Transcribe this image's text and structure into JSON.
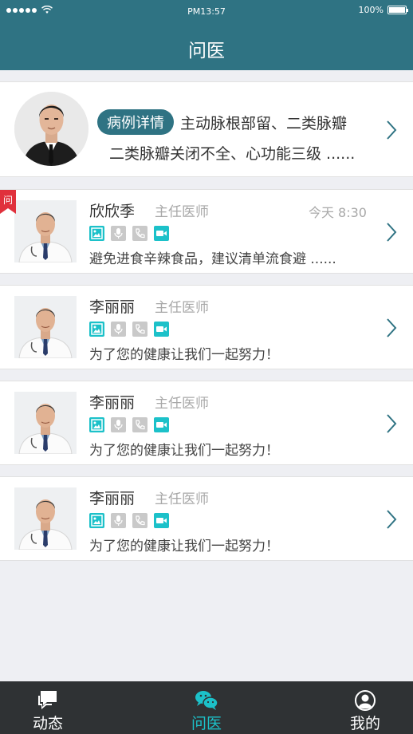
{
  "status_bar": {
    "time": "PM13:57",
    "battery": "100%"
  },
  "header": {
    "title": "问医"
  },
  "case_card": {
    "badge": "病例详情",
    "line1": "主动脉根部留、二类脉瓣",
    "line2": "二类脉瓣关闭不全、心功能三级 ......"
  },
  "doctors": [
    {
      "name": "欣欣季",
      "title": "主任医师",
      "time": "今天 8:30",
      "message": "避免进食辛辣食品，建议清单流食避 ......",
      "tag": "问"
    },
    {
      "name": "李丽丽",
      "title": "主任医师",
      "message": "为了您的健康让我们一起努力！"
    },
    {
      "name": "李丽丽",
      "title": "主任医师",
      "message": "为了您的健康让我们一起努力！"
    },
    {
      "name": "李丽丽",
      "title": "主任医师",
      "message": "为了您的健康让我们一起努力！"
    }
  ],
  "service_icons": [
    "image-icon",
    "microphone-icon",
    "phone-icon",
    "video-icon"
  ],
  "tabs": [
    {
      "label": "动态",
      "icon": "chat-bubbles-icon",
      "active": false
    },
    {
      "label": "问医",
      "icon": "wechat-icon",
      "active": true
    },
    {
      "label": "我的",
      "icon": "person-icon",
      "active": false
    }
  ],
  "colors": {
    "primary": "#2f7383",
    "accent": "#1cc1c9",
    "tabbar": "#2f3234",
    "tag_red": "#e0303c"
  }
}
